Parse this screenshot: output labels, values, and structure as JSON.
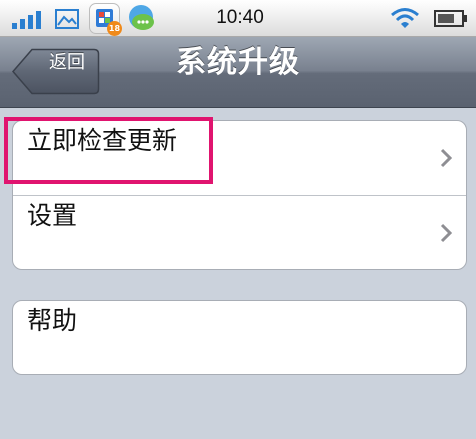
{
  "status_bar": {
    "time": "10:40",
    "badge_count": "18",
    "icons": [
      "signal-icon",
      "gallery-icon",
      "app-icon",
      "chat-app-icon",
      "wifi-icon",
      "battery-icon"
    ]
  },
  "nav": {
    "back_label": "返回",
    "title": "系统升级"
  },
  "groups": [
    {
      "items": [
        {
          "label": "立即检查更新",
          "chevron": true,
          "highlighted": true
        },
        {
          "label": "设置",
          "chevron": true
        }
      ]
    },
    {
      "items": [
        {
          "label": "帮助",
          "chevron": false
        }
      ]
    }
  ],
  "colors": {
    "nav_bar": "#79818f",
    "background": "#cbd2dc",
    "highlight": "#e0146f"
  }
}
